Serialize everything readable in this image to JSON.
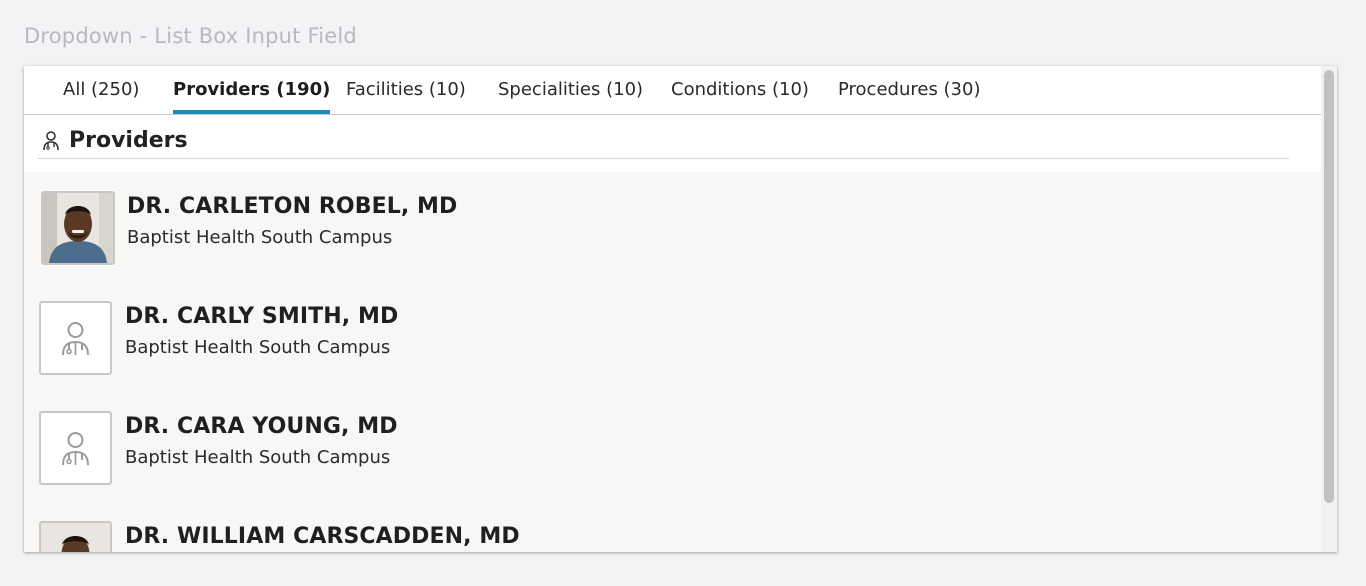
{
  "frame": {
    "title": "Dropdown - List Box Input Field"
  },
  "tabs": [
    {
      "label": "All (250)"
    },
    {
      "label": "Providers (190)"
    },
    {
      "label": "Facilities (10)"
    },
    {
      "label": "Specialities (10)"
    },
    {
      "label": "Conditions (10)"
    },
    {
      "label": "Procedures (30)"
    }
  ],
  "active_tab": "Providers (190)",
  "section": {
    "title": "Providers",
    "icon": "doctor-icon"
  },
  "providers": [
    {
      "name": "DR. CARLETON ROBEL, MD",
      "location": "Baptist Health South Campus",
      "avatar": "photo"
    },
    {
      "name": "DR. CARLY SMITH, MD",
      "location": "Baptist Health South Campus",
      "avatar": "placeholder-doctor-icon"
    },
    {
      "name": "DR. CARA YOUNG, MD",
      "location": "Baptist Health South Campus",
      "avatar": "placeholder-doctor-icon"
    },
    {
      "name": "DR. WILLIAM CARSCADDEN, MD",
      "location": "",
      "avatar": "photo"
    }
  ],
  "colors": {
    "active_tab_underline": "#1a8cb8",
    "list_background": "#f8f7f5"
  }
}
